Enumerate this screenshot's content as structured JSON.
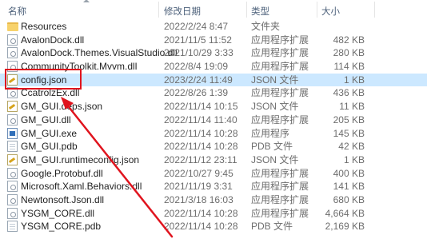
{
  "columns": {
    "name": "名称",
    "date": "修改日期",
    "type": "类型",
    "size": "大小"
  },
  "files": [
    {
      "name": "Resources",
      "date": "2022/2/24 8:47",
      "type": "文件夹",
      "size": "",
      "icon": "folder-icon"
    },
    {
      "name": "AvalonDock.dll",
      "date": "2021/11/5 11:52",
      "type": "应用程序扩展",
      "size": "482 KB",
      "icon": "dll-file-icon"
    },
    {
      "name": "AvalonDock.Themes.VisualStudio.dll",
      "date": "2021/10/29 3:33",
      "type": "应用程序扩展",
      "size": "280 KB",
      "icon": "dll-file-icon"
    },
    {
      "name": "CommunityToolkit.Mvvm.dll",
      "date": "2022/8/4 19:09",
      "type": "应用程序扩展",
      "size": "114 KB",
      "icon": "dll-file-icon"
    },
    {
      "name": "config.json",
      "date": "2023/2/24 11:49",
      "type": "JSON 文件",
      "size": "1 KB",
      "icon": "json-file-icon",
      "selected": true
    },
    {
      "name": "CcatrolzEx.dll",
      "date": "2022/8/26 1:39",
      "type": "应用程序扩展",
      "size": "436 KB",
      "icon": "dll-file-icon"
    },
    {
      "name": "GM_GUI.deps.json",
      "date": "2022/11/14 10:15",
      "type": "JSON 文件",
      "size": "11 KB",
      "icon": "json-file-icon"
    },
    {
      "name": "GM_GUI.dll",
      "date": "2022/11/14 11:40",
      "type": "应用程序扩展",
      "size": "205 KB",
      "icon": "dll-file-icon"
    },
    {
      "name": "GM_GUI.exe",
      "date": "2022/11/14 10:28",
      "type": "应用程序",
      "size": "145 KB",
      "icon": "exe-file-icon"
    },
    {
      "name": "GM_GUI.pdb",
      "date": "2022/11/14 10:28",
      "type": "PDB 文件",
      "size": "42 KB",
      "icon": "pdb-file-icon"
    },
    {
      "name": "GM_GUI.runtimeconfig.json",
      "date": "2022/11/12 23:11",
      "type": "JSON 文件",
      "size": "1 KB",
      "icon": "json-file-icon"
    },
    {
      "name": "Google.Protobuf.dll",
      "date": "2022/10/27 9:45",
      "type": "应用程序扩展",
      "size": "400 KB",
      "icon": "dll-file-icon"
    },
    {
      "name": "Microsoft.Xaml.Behaviors.dll",
      "date": "2021/11/19 3:31",
      "type": "应用程序扩展",
      "size": "141 KB",
      "icon": "dll-file-icon"
    },
    {
      "name": "Newtonsoft.Json.dll",
      "date": "2021/3/18 16:03",
      "type": "应用程序扩展",
      "size": "680 KB",
      "icon": "dll-file-icon"
    },
    {
      "name": "YSGM_CORE.dll",
      "date": "2022/11/14 10:28",
      "type": "应用程序扩展",
      "size": "4,664 KB",
      "icon": "dll-file-icon"
    },
    {
      "name": "YSGM_CORE.pdb",
      "date": "2022/11/14 10:28",
      "type": "PDB 文件",
      "size": "2,169 KB",
      "icon": "pdb-file-icon"
    }
  ],
  "colors": {
    "selection": "#cce8ff",
    "annotation": "#e0141e"
  }
}
